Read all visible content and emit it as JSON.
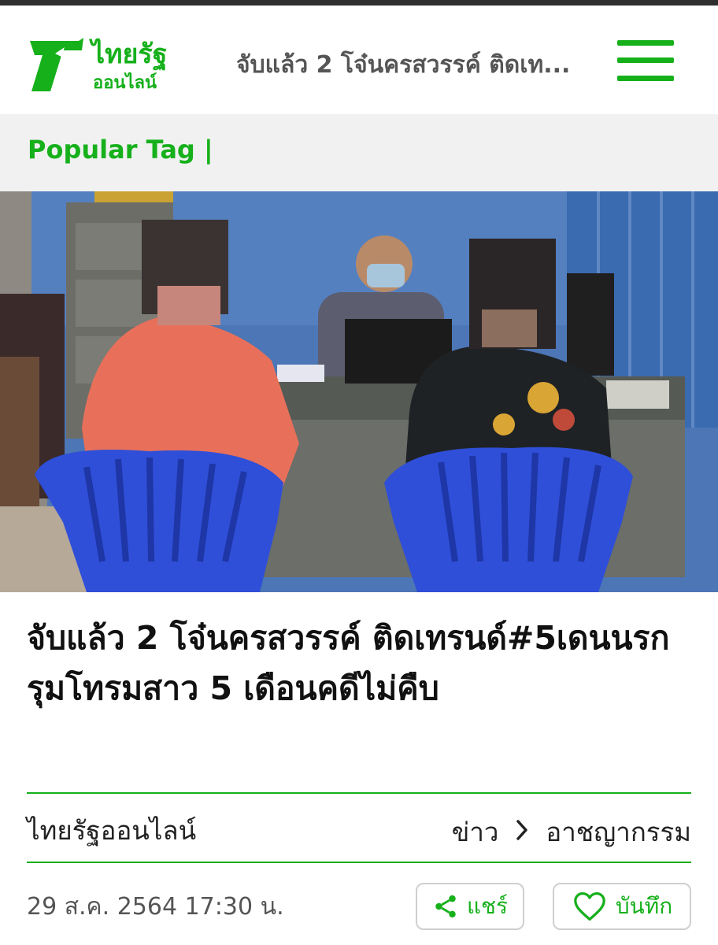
{
  "header": {
    "logo_text": "ไทยรัฐ",
    "logo_subtext": "ออนไลน์",
    "title": "จับแล้ว 2 โจ๋นครสวรรค์ ติดเท...",
    "menu_icon": "hamburger-menu-icon"
  },
  "tagbar": {
    "label": "Popular Tag |"
  },
  "article": {
    "headline": "จับแล้ว 2 โจ๋นครสวรรค์ ติดเทรนด์#5เดนนรก รุมโทรมสาว 5 เดือนคดีไม่คืบ",
    "source": "ไทยรัฐออนไลน์",
    "breadcrumb": [
      "ข่าว",
      "อาชญากรรม"
    ],
    "date": "29 ส.ค. 2564 17:30 น.",
    "share_label": "แชร์",
    "save_label": "บันทึก"
  },
  "colors": {
    "brand_green": "#16b01b",
    "title_gray": "#555555"
  }
}
